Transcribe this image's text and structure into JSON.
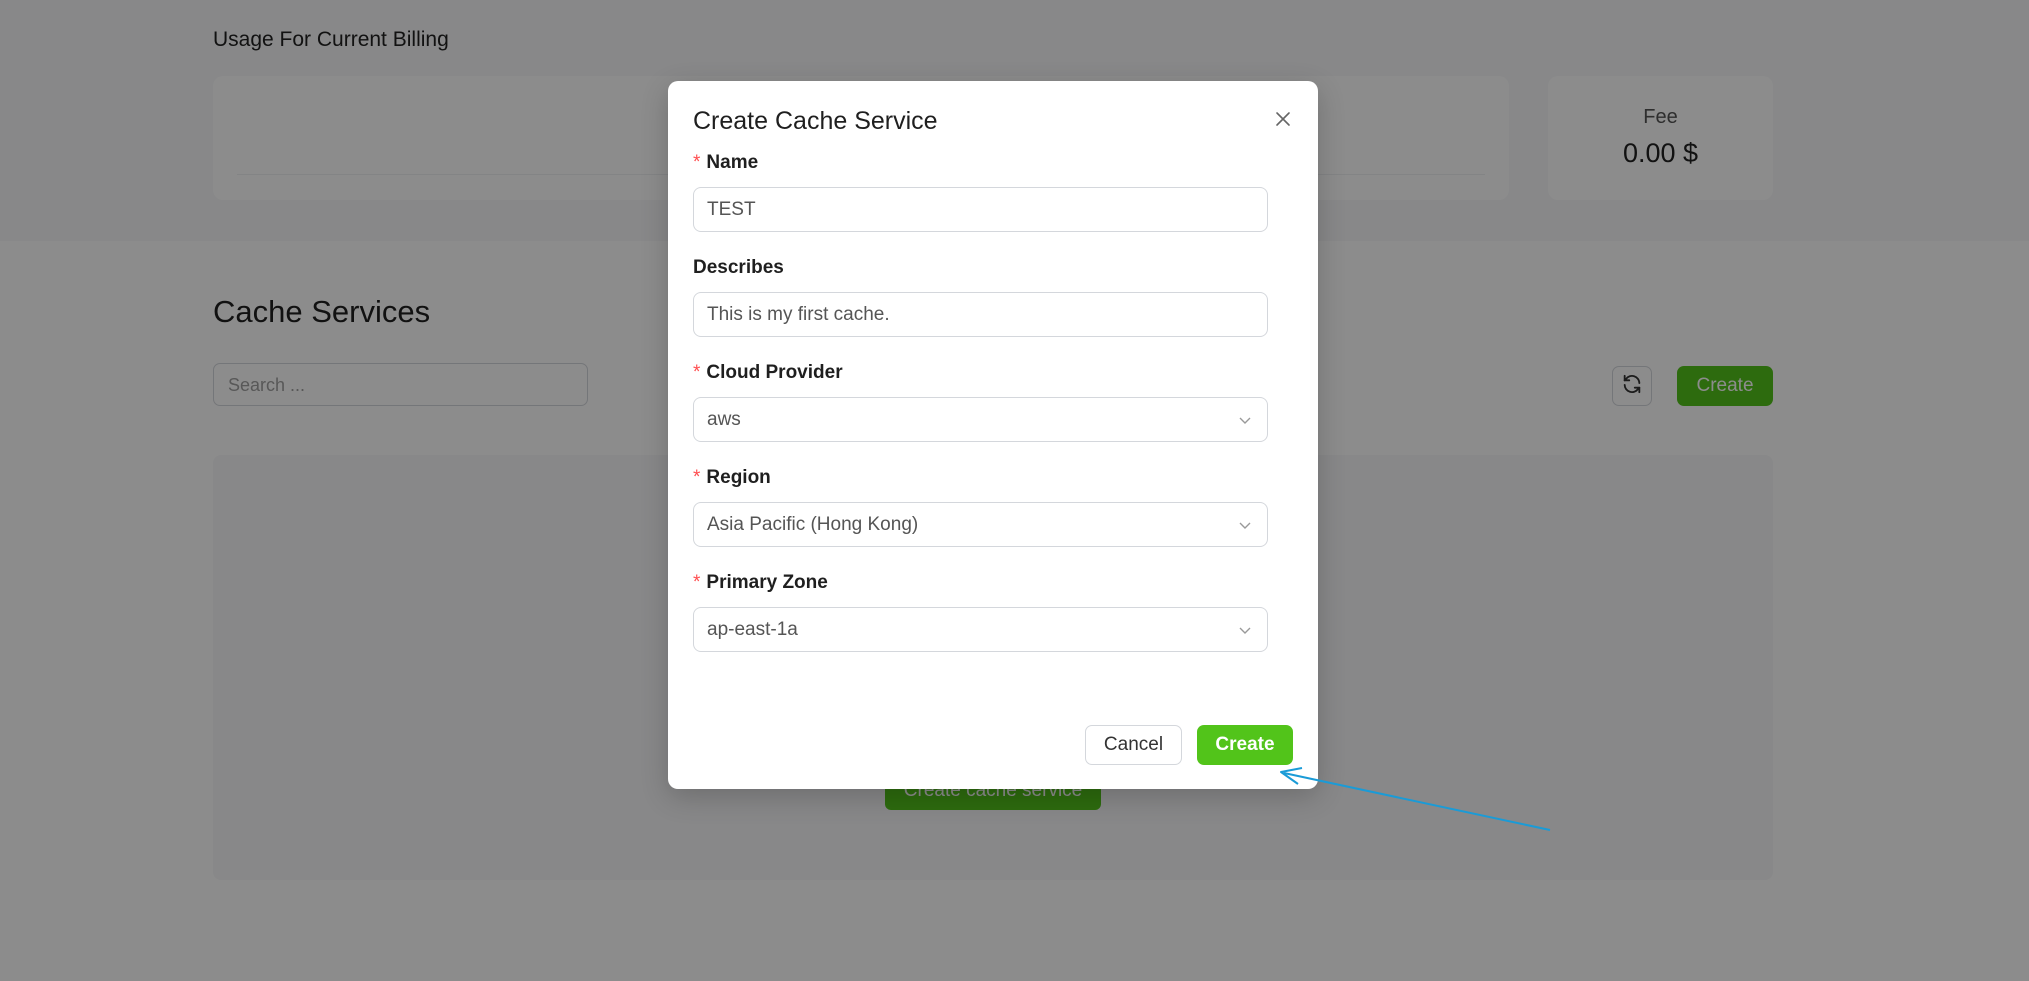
{
  "billing": {
    "title": "Usage For Current Billing",
    "fee_label": "Fee",
    "fee_value": "0.00 $"
  },
  "services": {
    "title": "Cache Services",
    "search_placeholder": "Search ...",
    "create_label": "Create",
    "empty_create_label": "Create cache service"
  },
  "modal": {
    "title": "Create Cache Service",
    "name_label": "Name",
    "name_value": "TEST",
    "describes_label": "Describes",
    "describes_value": "This is my first cache.",
    "provider_label": "Cloud Provider",
    "provider_value": "aws",
    "region_label": "Region",
    "region_value": "Asia Pacific (Hong Kong)",
    "zone_label": "Primary Zone",
    "zone_value": "ap-east-1a",
    "cancel_label": "Cancel",
    "create_label": "Create",
    "required_mark": "*"
  },
  "colors": {
    "primary_green": "#52c41a",
    "required_red": "#ff4d4f",
    "annotation_arrow": "#1a9bd7"
  },
  "icons": [
    "close-icon",
    "chevron-down-icon",
    "refresh-icon"
  ]
}
